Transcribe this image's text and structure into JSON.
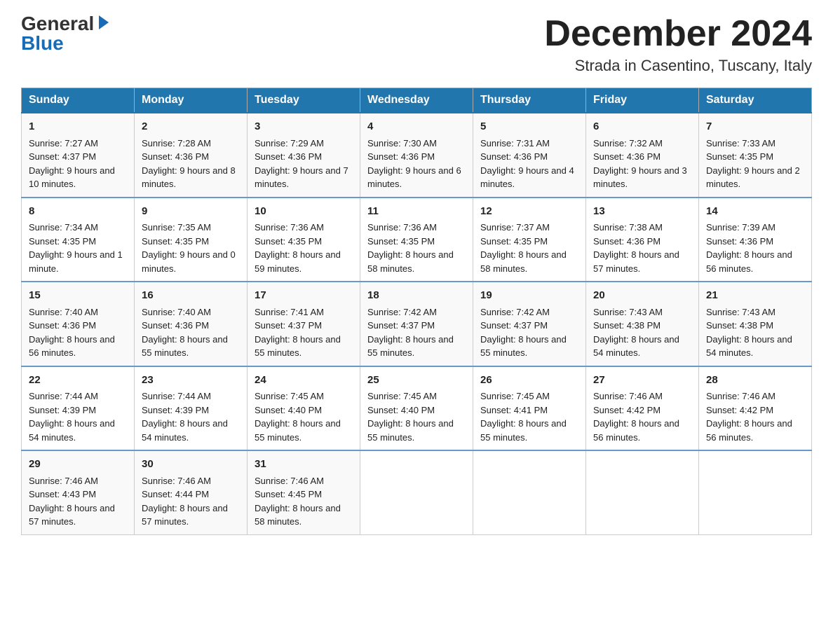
{
  "logo": {
    "general": "General",
    "blue": "Blue"
  },
  "title": {
    "month": "December 2024",
    "location": "Strada in Casentino, Tuscany, Italy"
  },
  "headers": [
    "Sunday",
    "Monday",
    "Tuesday",
    "Wednesday",
    "Thursday",
    "Friday",
    "Saturday"
  ],
  "weeks": [
    [
      {
        "day": "1",
        "sunrise": "7:27 AM",
        "sunset": "4:37 PM",
        "daylight": "9 hours and 10 minutes."
      },
      {
        "day": "2",
        "sunrise": "7:28 AM",
        "sunset": "4:36 PM",
        "daylight": "9 hours and 8 minutes."
      },
      {
        "day": "3",
        "sunrise": "7:29 AM",
        "sunset": "4:36 PM",
        "daylight": "9 hours and 7 minutes."
      },
      {
        "day": "4",
        "sunrise": "7:30 AM",
        "sunset": "4:36 PM",
        "daylight": "9 hours and 6 minutes."
      },
      {
        "day": "5",
        "sunrise": "7:31 AM",
        "sunset": "4:36 PM",
        "daylight": "9 hours and 4 minutes."
      },
      {
        "day": "6",
        "sunrise": "7:32 AM",
        "sunset": "4:36 PM",
        "daylight": "9 hours and 3 minutes."
      },
      {
        "day": "7",
        "sunrise": "7:33 AM",
        "sunset": "4:35 PM",
        "daylight": "9 hours and 2 minutes."
      }
    ],
    [
      {
        "day": "8",
        "sunrise": "7:34 AM",
        "sunset": "4:35 PM",
        "daylight": "9 hours and 1 minute."
      },
      {
        "day": "9",
        "sunrise": "7:35 AM",
        "sunset": "4:35 PM",
        "daylight": "9 hours and 0 minutes."
      },
      {
        "day": "10",
        "sunrise": "7:36 AM",
        "sunset": "4:35 PM",
        "daylight": "8 hours and 59 minutes."
      },
      {
        "day": "11",
        "sunrise": "7:36 AM",
        "sunset": "4:35 PM",
        "daylight": "8 hours and 58 minutes."
      },
      {
        "day": "12",
        "sunrise": "7:37 AM",
        "sunset": "4:35 PM",
        "daylight": "8 hours and 58 minutes."
      },
      {
        "day": "13",
        "sunrise": "7:38 AM",
        "sunset": "4:36 PM",
        "daylight": "8 hours and 57 minutes."
      },
      {
        "day": "14",
        "sunrise": "7:39 AM",
        "sunset": "4:36 PM",
        "daylight": "8 hours and 56 minutes."
      }
    ],
    [
      {
        "day": "15",
        "sunrise": "7:40 AM",
        "sunset": "4:36 PM",
        "daylight": "8 hours and 56 minutes."
      },
      {
        "day": "16",
        "sunrise": "7:40 AM",
        "sunset": "4:36 PM",
        "daylight": "8 hours and 55 minutes."
      },
      {
        "day": "17",
        "sunrise": "7:41 AM",
        "sunset": "4:37 PM",
        "daylight": "8 hours and 55 minutes."
      },
      {
        "day": "18",
        "sunrise": "7:42 AM",
        "sunset": "4:37 PM",
        "daylight": "8 hours and 55 minutes."
      },
      {
        "day": "19",
        "sunrise": "7:42 AM",
        "sunset": "4:37 PM",
        "daylight": "8 hours and 55 minutes."
      },
      {
        "day": "20",
        "sunrise": "7:43 AM",
        "sunset": "4:38 PM",
        "daylight": "8 hours and 54 minutes."
      },
      {
        "day": "21",
        "sunrise": "7:43 AM",
        "sunset": "4:38 PM",
        "daylight": "8 hours and 54 minutes."
      }
    ],
    [
      {
        "day": "22",
        "sunrise": "7:44 AM",
        "sunset": "4:39 PM",
        "daylight": "8 hours and 54 minutes."
      },
      {
        "day": "23",
        "sunrise": "7:44 AM",
        "sunset": "4:39 PM",
        "daylight": "8 hours and 54 minutes."
      },
      {
        "day": "24",
        "sunrise": "7:45 AM",
        "sunset": "4:40 PM",
        "daylight": "8 hours and 55 minutes."
      },
      {
        "day": "25",
        "sunrise": "7:45 AM",
        "sunset": "4:40 PM",
        "daylight": "8 hours and 55 minutes."
      },
      {
        "day": "26",
        "sunrise": "7:45 AM",
        "sunset": "4:41 PM",
        "daylight": "8 hours and 55 minutes."
      },
      {
        "day": "27",
        "sunrise": "7:46 AM",
        "sunset": "4:42 PM",
        "daylight": "8 hours and 56 minutes."
      },
      {
        "day": "28",
        "sunrise": "7:46 AM",
        "sunset": "4:42 PM",
        "daylight": "8 hours and 56 minutes."
      }
    ],
    [
      {
        "day": "29",
        "sunrise": "7:46 AM",
        "sunset": "4:43 PM",
        "daylight": "8 hours and 57 minutes."
      },
      {
        "day": "30",
        "sunrise": "7:46 AM",
        "sunset": "4:44 PM",
        "daylight": "8 hours and 57 minutes."
      },
      {
        "day": "31",
        "sunrise": "7:46 AM",
        "sunset": "4:45 PM",
        "daylight": "8 hours and 58 minutes."
      },
      null,
      null,
      null,
      null
    ]
  ]
}
